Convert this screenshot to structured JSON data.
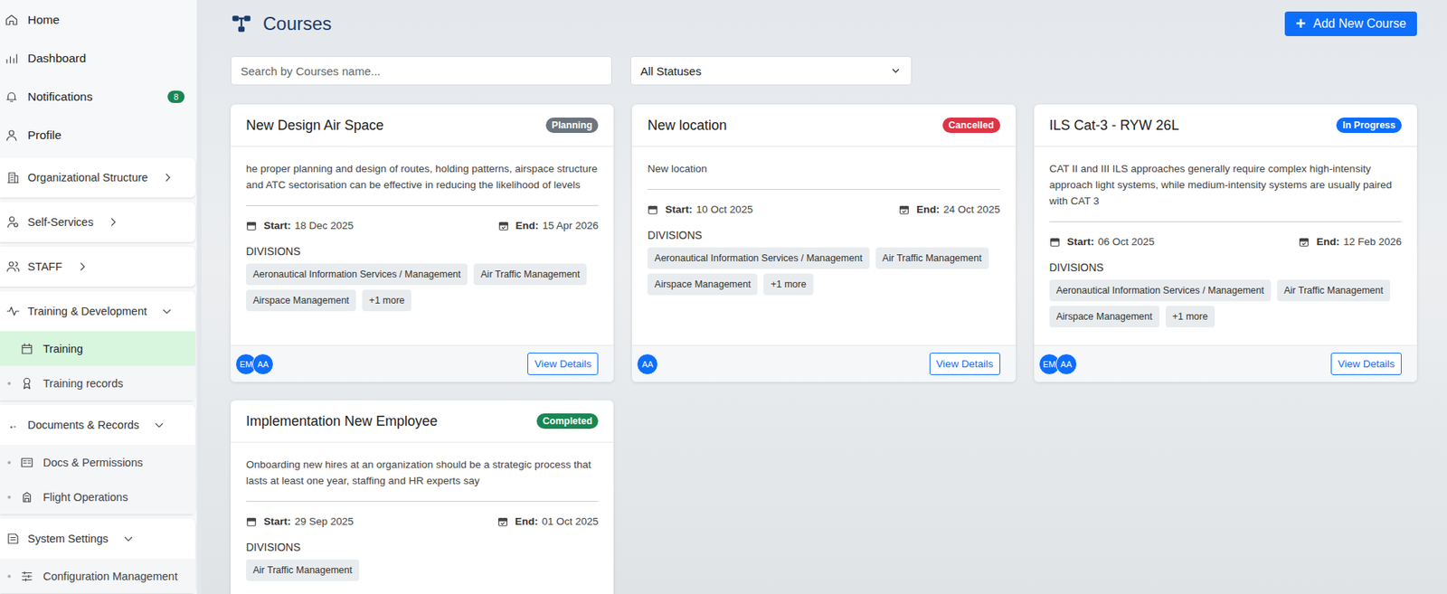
{
  "sidebar": {
    "items": [
      {
        "label": "Home",
        "kind": "link",
        "selected": false
      },
      {
        "label": "Dashboard",
        "kind": "link",
        "selected": false
      },
      {
        "label": "Notifications",
        "kind": "link",
        "selected": false,
        "badge": "8"
      },
      {
        "label": "Profile",
        "kind": "link",
        "selected": false
      },
      {
        "label": "Organizational Structure",
        "kind": "group",
        "expanded": false,
        "children": []
      },
      {
        "label": "Self-Services",
        "kind": "group",
        "expanded": false,
        "children": []
      },
      {
        "label": "STAFF",
        "kind": "group",
        "expanded": false,
        "children": []
      },
      {
        "label": "Training & Development",
        "kind": "group",
        "expanded": true,
        "children": [
          {
            "label": "Training",
            "selected": true
          },
          {
            "label": "Training records",
            "selected": false
          }
        ]
      },
      {
        "label": "Documents & Records",
        "kind": "group",
        "expanded": true,
        "children": [
          {
            "label": "Docs & Permissions",
            "selected": false
          },
          {
            "label": "Flight Operations",
            "selected": false
          }
        ]
      },
      {
        "label": "System Settings",
        "kind": "group",
        "expanded": true,
        "children": [
          {
            "label": "Configuration Management",
            "selected": false
          }
        ]
      }
    ]
  },
  "page": {
    "title": "Courses",
    "add_button": "Add New Course",
    "add_icon": "+"
  },
  "search": {
    "placeholder": "Search by Courses name..."
  },
  "status_filter": {
    "value": "All Statuses"
  },
  "labels": {
    "start": "Start:",
    "end": "End:",
    "divisions": "DIVISIONS",
    "view": "View Details"
  },
  "courses": [
    {
      "title": "New Design Air Space",
      "status": "Planning",
      "color": "#6c757d",
      "description": "he proper planning and design of routes, holding patterns, airspace structure and ATC sectorisation can be effective in reducing the likelihood of levels",
      "start": "18 Dec 2025",
      "end": "15 Apr 2026",
      "divisions": [
        "Aeronautical Information Services / Management",
        "Air Traffic Management",
        "Airspace Management"
      ],
      "more": "+1 more",
      "avatars": [
        "EM",
        "AA"
      ]
    },
    {
      "title": "New location",
      "status": "Cancelled",
      "color": "#dc3545",
      "description": "New location",
      "start": "10 Oct 2025",
      "end": "24 Oct 2025",
      "divisions": [
        "Aeronautical Information Services / Management",
        "Air Traffic Management",
        "Airspace Management"
      ],
      "more": "+1 more",
      "avatars": [
        "AA"
      ]
    },
    {
      "title": "ILS Cat-3 - RYW 26L",
      "status": "In Progress",
      "color": "#0d6efd",
      "description": "CAT II and III ILS approaches generally require complex high-intensity approach light systems, while medium-intensity systems are usually paired with CAT 3",
      "start": "06 Oct 2025",
      "end": "12 Feb 2026",
      "divisions": [
        "Aeronautical Information Services / Management",
        "Air Traffic Management",
        "Airspace Management"
      ],
      "more": "+1 more",
      "avatars": [
        "EM",
        "AA"
      ]
    },
    {
      "title": "Implementation New Employee",
      "status": "Completed",
      "color": "#198754",
      "description": "Onboarding new hires at an organization should be a strategic process that lasts at least one year, staffing and HR experts say",
      "start": "29 Sep 2025",
      "end": "01 Oct 2025",
      "divisions": [
        "Air Traffic Management"
      ],
      "more": "",
      "avatars": []
    }
  ]
}
